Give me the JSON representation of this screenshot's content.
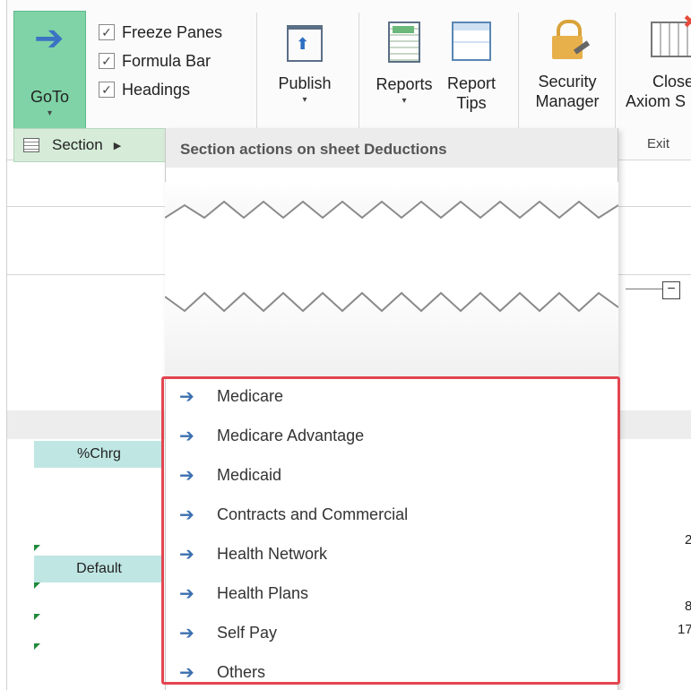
{
  "ribbon": {
    "goto": {
      "label": "GoTo",
      "drop": "▾"
    },
    "checks": [
      {
        "label": "Freeze Panes",
        "checked": true
      },
      {
        "label": "Formula Bar",
        "checked": true
      },
      {
        "label": "Headings",
        "checked": true
      }
    ],
    "publish": {
      "label": "Publish",
      "drop": "▾"
    },
    "reports": {
      "label": "Reports",
      "drop": "▾"
    },
    "report_tips": {
      "line1": "Report",
      "line2": "Tips"
    },
    "security": {
      "line1": "Security",
      "line2": "Manager"
    },
    "close": {
      "line1": "Close",
      "line2": "Axiom S"
    },
    "exit_group": "Exit"
  },
  "submenu": {
    "section_label": "Section",
    "header": "Section actions on sheet Deductions"
  },
  "items": [
    "Medicare",
    "Medicare Advantage",
    "Medicaid",
    "Contracts and Commercial",
    "Health Network",
    "Health Plans",
    "Self Pay",
    "Others"
  ],
  "sheet": {
    "chrg": "%Chrg",
    "default": "Default",
    "num1": "2",
    "num2": "8",
    "num3": "17"
  },
  "colors": {
    "goto_bg": "#7fd3a6",
    "highlight": "#e24550",
    "arrow": "#3b6fb0"
  }
}
